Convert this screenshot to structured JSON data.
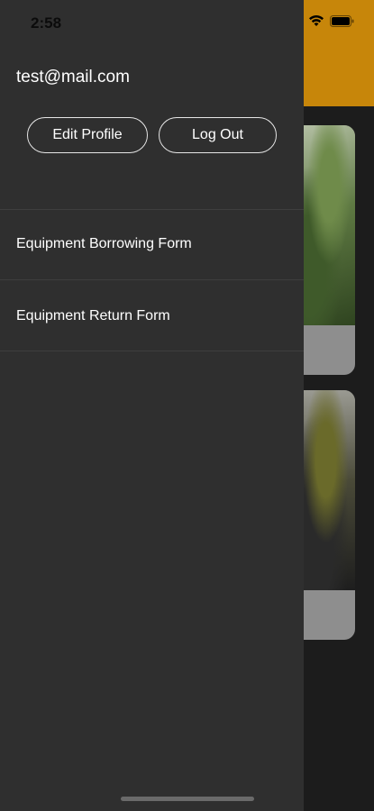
{
  "status_bar": {
    "time": "2:58"
  },
  "drawer": {
    "user_email": "test@mail.com",
    "edit_profile_label": "Edit Profile",
    "log_out_label": "Log Out",
    "menu_items": [
      {
        "label": "Equipment Borrowing Form"
      },
      {
        "label": "Equipment Return Form"
      }
    ]
  },
  "colors": {
    "drawer_bg": "#2f2f2f",
    "header_accent": "#c7860a",
    "app_bg": "#1c1c1c"
  }
}
